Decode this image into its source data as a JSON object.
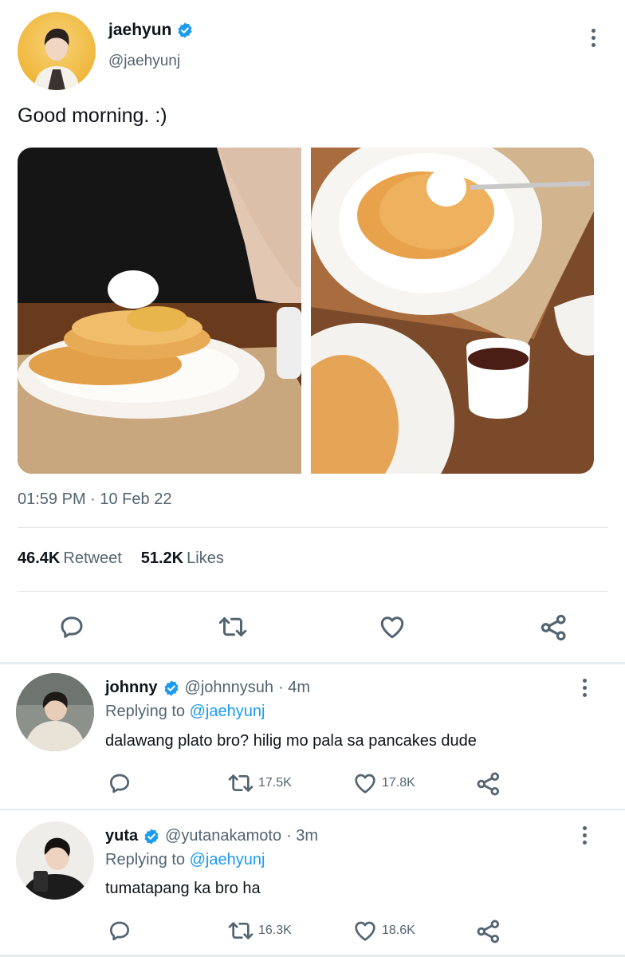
{
  "tweet": {
    "author_name": "jaehyun",
    "author_handle": "@jaehyunj",
    "text": "Good morning. :)",
    "timestamp": "01:59 PM · 10 Feb 22",
    "retweets_count": "46.4K",
    "retweets_label": "Retweet",
    "likes_count": "51.2K",
    "likes_label": "Likes"
  },
  "replies": [
    {
      "name": "johnny",
      "handle": "@johnnysuh",
      "time": "· 4m",
      "replying_prefix": "Replying to",
      "replying_to": "@jaehyunj",
      "text": "dalawang plato bro? hilig mo pala sa pancakes dude",
      "retweets": "17.5K",
      "likes": "17.8K"
    },
    {
      "name": "yuta",
      "handle": "@yutanakamoto",
      "time": "· 3m",
      "replying_prefix": "Replying to",
      "replying_to": "@jaehyunj",
      "text": "tumatapang ka bro ha",
      "retweets": "16.3K",
      "likes": "18.6K"
    }
  ],
  "colors": {
    "verified": "#1d9bf0",
    "secondary_text": "#536471",
    "link": "#1d9bf0"
  },
  "icons": [
    "verified-badge-icon",
    "more-icon",
    "reply-icon",
    "retweet-icon",
    "like-icon",
    "share-icon"
  ]
}
